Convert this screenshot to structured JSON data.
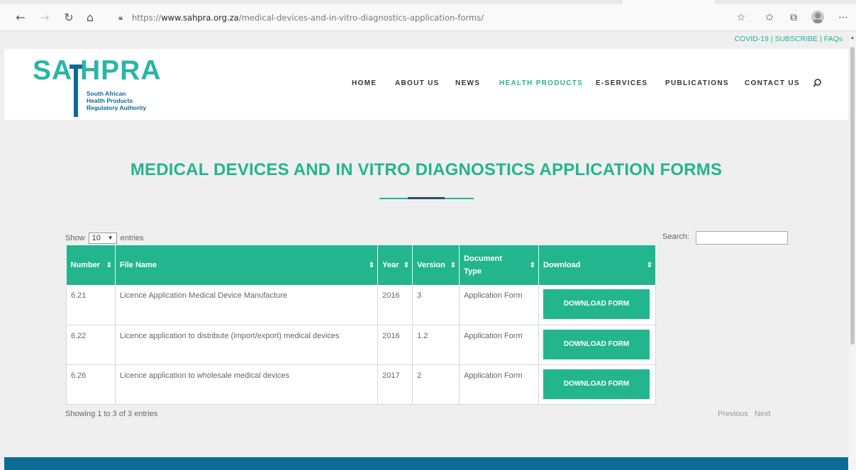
{
  "browser": {
    "url_prefix": "https://",
    "url_host": "www.sahpra.org.za",
    "url_path": "/medical-devices-and-in-vitro-diagnostics-application-forms/",
    "icons": [
      "back-icon",
      "forward-icon",
      "reload-icon",
      "home-icon",
      "lock-icon",
      "favorite-add-icon",
      "favorites-icon",
      "collections-icon",
      "profile-icon",
      "more-icon"
    ]
  },
  "toplinks": {
    "covid": "COVID-19",
    "subscribe": "SUBSCRIBE",
    "faqs": "FAQs",
    "separator": "|"
  },
  "logo": {
    "sa": "SA",
    "pra": "HPRA",
    "line1": "South African",
    "line2": "Health Products",
    "line3": "Regulatory Authority"
  },
  "nav": {
    "home": "HOME",
    "about": "ABOUT US",
    "news": "NEWS",
    "health_products": "HEALTH PRODUCTS",
    "eservices": "E-SERVICES",
    "publications": "PUBLICATIONS",
    "contact": "CONTACT US"
  },
  "page": {
    "title": "MEDICAL DEVICES AND IN VITRO DIAGNOSTICS APPLICATION FORMS"
  },
  "table_controls": {
    "show_label": "Show",
    "entries_label": "entries",
    "page_length": "10",
    "search_label": "Search:",
    "search_value": ""
  },
  "table": {
    "columns": {
      "number": "Number",
      "file_name": "File Name",
      "year": "Year",
      "version": "Version",
      "doc_type_1": "Document",
      "doc_type_2": "Type",
      "download": "Download"
    },
    "rows": [
      {
        "number": "6.21",
        "file_name": "Licence Application Medical Device Manufacture",
        "year": "2016",
        "version": "3",
        "doc_type": "Application Form",
        "download": "DOWNLOAD FORM"
      },
      {
        "number": "6.22",
        "file_name": "Licence application to distribute (import/export) medical devices",
        "year": "2016",
        "version": "1.2",
        "doc_type": "Application Form",
        "download": "DOWNLOAD FORM"
      },
      {
        "number": "6.26",
        "file_name": "Licence application to wholesale medical devices",
        "year": "2017",
        "version": "2",
        "doc_type": "Application Form",
        "download": "DOWNLOAD FORM"
      }
    ]
  },
  "footer_info": {
    "showing": "Showing 1 to 3 of 3 entries",
    "previous": "Previous",
    "next": "Next"
  },
  "colors": {
    "brand_green": "#23b58e",
    "brand_blue": "#0d6b96",
    "page_bg": "#efefef"
  }
}
